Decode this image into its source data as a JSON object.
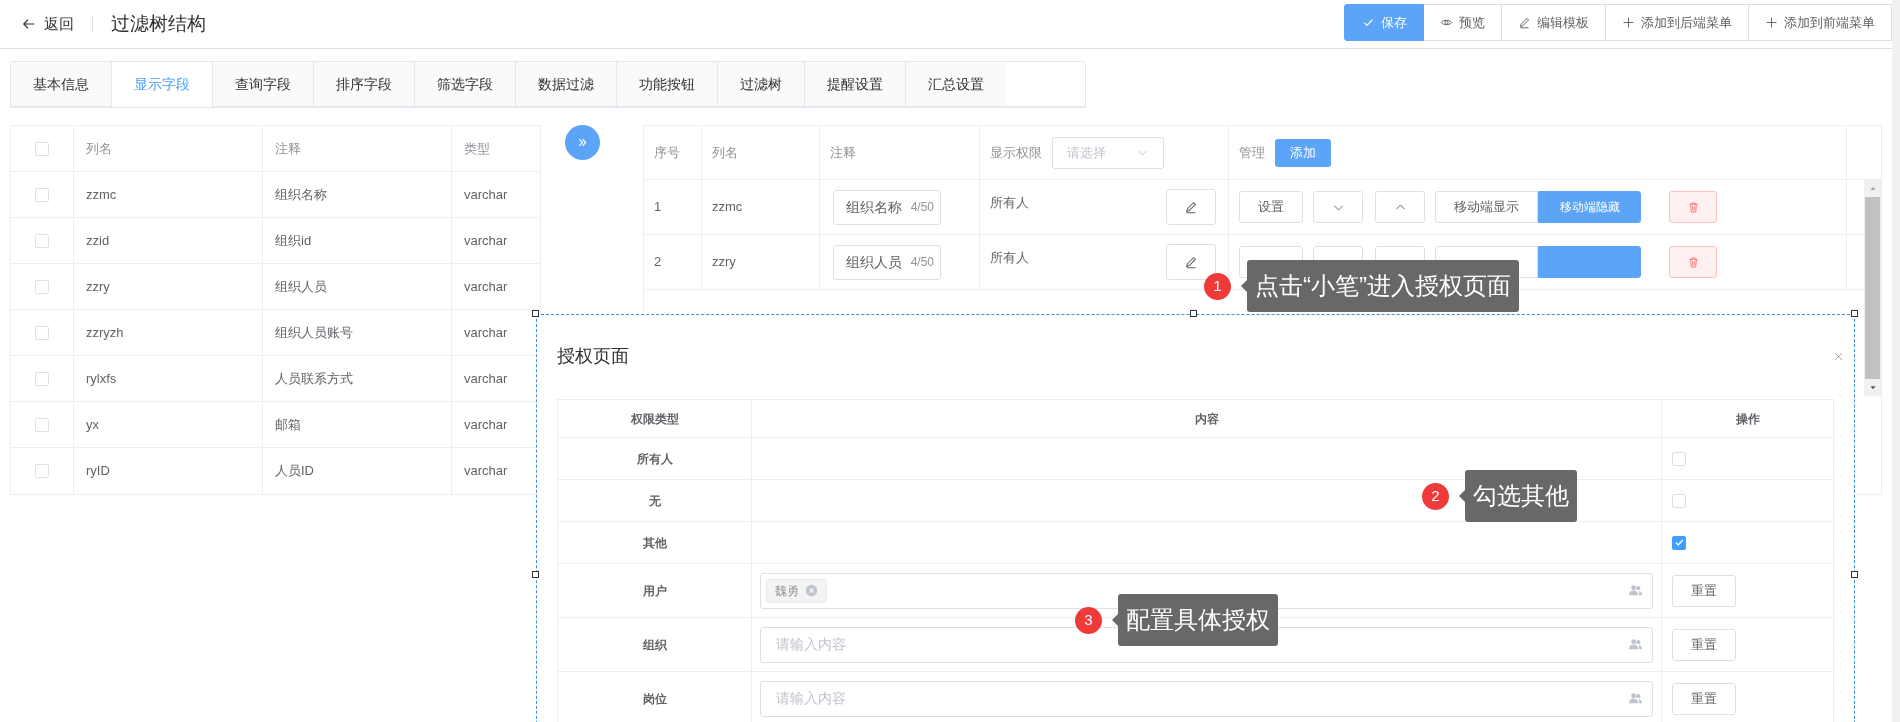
{
  "header": {
    "back": "返回",
    "title": "过滤树结构",
    "actions": [
      {
        "label": "保存",
        "kind": "primary"
      },
      {
        "label": "预览",
        "kind": "plain"
      },
      {
        "label": "编辑模板",
        "kind": "plain"
      },
      {
        "label": "添加到后端菜单",
        "kind": "plain"
      },
      {
        "label": "添加到前端菜单",
        "kind": "plain"
      }
    ]
  },
  "tabs": [
    {
      "label": "基本信息",
      "selected": false
    },
    {
      "label": "显示字段",
      "selected": true
    },
    {
      "label": "查询字段",
      "selected": false
    },
    {
      "label": "排序字段",
      "selected": false
    },
    {
      "label": "筛选字段",
      "selected": false
    },
    {
      "label": "数据过滤",
      "selected": false
    },
    {
      "label": "功能按钮",
      "selected": false
    },
    {
      "label": "过滤树",
      "selected": false
    },
    {
      "label": "提醒设置",
      "selected": false
    },
    {
      "label": "汇总设置",
      "selected": false
    }
  ],
  "field_table": {
    "header_checked": false,
    "columns": [
      "列名",
      "注释",
      "类型"
    ],
    "rows": [
      {
        "checked": false,
        "name": "zzmc",
        "comment": "组织名称",
        "type": "varchar"
      },
      {
        "checked": false,
        "name": "zzid",
        "comment": "组织id",
        "type": "varchar"
      },
      {
        "checked": false,
        "name": "zzry",
        "comment": "组织人员",
        "type": "varchar"
      },
      {
        "checked": false,
        "name": "zzryzh",
        "comment": "组织人员账号",
        "type": "varchar"
      },
      {
        "checked": false,
        "name": "rylxfs",
        "comment": "人员联系方式",
        "type": "varchar"
      },
      {
        "checked": false,
        "name": "yx",
        "comment": "邮箱",
        "type": "varchar"
      },
      {
        "checked": false,
        "name": "ryID",
        "comment": "人员ID",
        "type": "varchar"
      }
    ]
  },
  "display_table": {
    "columns": [
      "序号",
      "列名",
      "注释",
      "显示权限",
      "管理"
    ],
    "permission_filter": {
      "placeholder": "请选择"
    },
    "add_button": "添加",
    "rows": [
      {
        "index": "1",
        "name": "zzmc",
        "comment": "组织名称",
        "counter": "4/50",
        "permission": "所有人",
        "settings": "设置",
        "mobile_show": "移动端显示",
        "mobile_hide": "移动端隐藏"
      },
      {
        "index": "2",
        "name": "zzry",
        "comment": "组织人员",
        "counter": "4/50",
        "permission": "所有人"
      }
    ]
  },
  "dialog": {
    "title": "授权页面",
    "columns": [
      "权限类型",
      "内容",
      "操作"
    ],
    "rows": [
      {
        "kind": "check",
        "label": "所有人",
        "checked": false
      },
      {
        "kind": "check",
        "label": "无",
        "checked": false
      },
      {
        "kind": "check",
        "label": "其他",
        "checked": true
      },
      {
        "kind": "picker",
        "label": "用户",
        "tags": [
          "魏勇"
        ],
        "action": "重置"
      },
      {
        "kind": "picker",
        "label": "组织",
        "placeholder": "请输入内容",
        "action": "重置"
      },
      {
        "kind": "picker",
        "label": "岗位",
        "placeholder": "请输入内容",
        "action": "重置"
      }
    ]
  },
  "callouts": [
    {
      "number": "1",
      "text": "点击“小笔”进入授权页面"
    },
    {
      "number": "2",
      "text": "勾选其他"
    },
    {
      "number": "3",
      "text": "配置具体授权"
    }
  ]
}
